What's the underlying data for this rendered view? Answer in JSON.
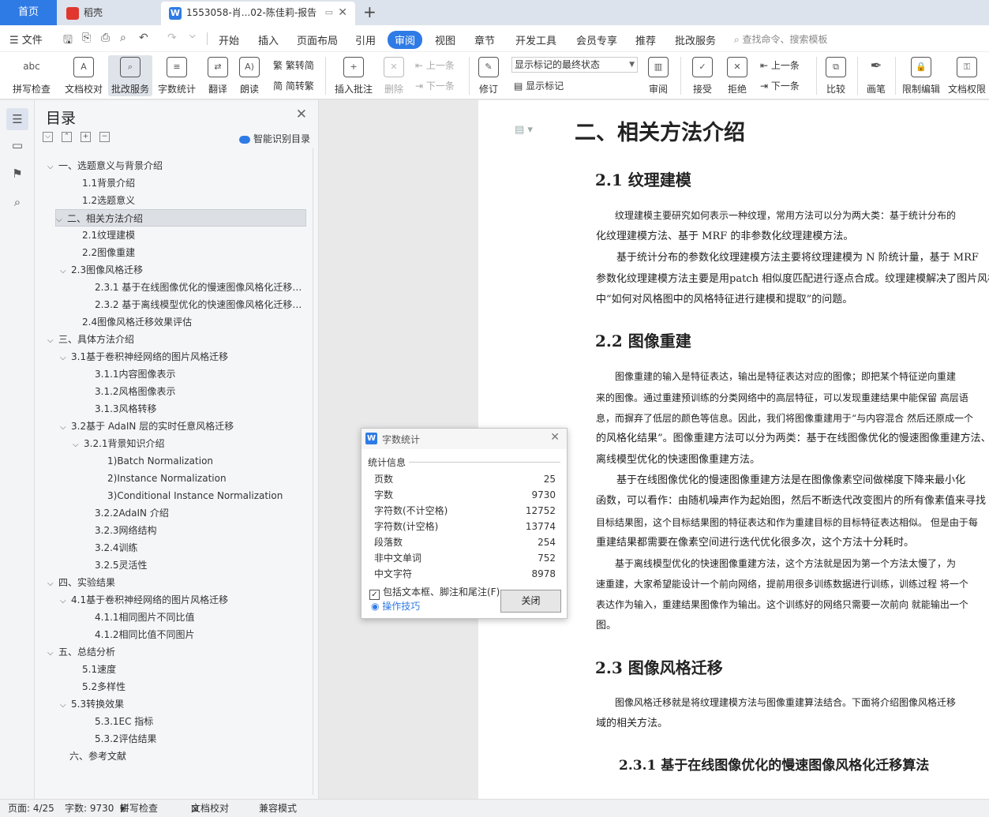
{
  "tabs": {
    "home": "首页",
    "t1": "稻壳",
    "t2": "1553058-肖...02-陈佳莉-报告",
    "add": "+",
    "doc_icon": "W"
  },
  "menu": {
    "file": "文件",
    "items": [
      "开始",
      "插入",
      "页面布局",
      "引用",
      "审阅",
      "视图",
      "章节",
      "开发工具",
      "会员专享",
      "推荐",
      "批改服务"
    ],
    "active": "审阅",
    "search": "查找命令、搜索模板"
  },
  "ribbon": {
    "spell": "拼写检查",
    "proof": "文档校对",
    "correct": "批改服务",
    "wordcount": "字数统计",
    "translate": "翻译",
    "read": "朗读",
    "trad": "繁转简",
    "simp": "简转繁",
    "insert_comment": "插入批注",
    "delete": "删除",
    "prev": "上一条",
    "next": "下一条",
    "revise": "修订",
    "markup_state": "显示标记的最终状态",
    "show_markup": "显示标记",
    "review": "审阅",
    "accept": "接受",
    "reject": "拒绝",
    "prev2": "上一条",
    "next2": "下一条",
    "compare": "比较",
    "pen": "画笔",
    "restrict": "限制编辑",
    "perm": "文档权限",
    "icon_abc": "abc"
  },
  "toc": {
    "title": "目录",
    "smart": "智能识别目录",
    "items": [
      {
        "label": "一、选题意义与背景介绍",
        "toggle": "⌵"
      },
      {
        "label": "1.1背景介绍",
        "toggle": ""
      },
      {
        "label": "1.2选题意义",
        "toggle": ""
      },
      {
        "label": "二、相关方法介绍",
        "toggle": "⌵"
      },
      {
        "label": "2.1纹理建模",
        "toggle": ""
      },
      {
        "label": "2.2图像重建",
        "toggle": ""
      },
      {
        "label": "2.3图像风格迁移",
        "toggle": "⌵"
      },
      {
        "label": "2.3.1 基于在线图像优化的慢速图像风格化迁移算法",
        "toggle": ""
      },
      {
        "label": "2.3.2 基于离线模型优化的快速图像风格化迁移算法",
        "toggle": ""
      },
      {
        "label": "2.4图像风格迁移效果评估",
        "toggle": ""
      },
      {
        "label": "三、具体方法介绍",
        "toggle": "⌵"
      },
      {
        "label": "3.1基于卷积神经网络的图片风格迁移",
        "toggle": "⌵"
      },
      {
        "label": "3.1.1内容图像表示",
        "toggle": ""
      },
      {
        "label": "3.1.2风格图像表示",
        "toggle": ""
      },
      {
        "label": "3.1.3风格转移",
        "toggle": ""
      },
      {
        "label": "3.2基于 AdaIN 层的实时任意风格迁移",
        "toggle": "⌵"
      },
      {
        "label": "3.2.1背景知识介绍",
        "toggle": "⌵"
      },
      {
        "label": "1)Batch Normalization",
        "toggle": ""
      },
      {
        "label": "2)Instance Normalization",
        "toggle": ""
      },
      {
        "label": "3)Conditional Instance Normalization",
        "toggle": ""
      },
      {
        "label": "3.2.2AdaIN 介绍",
        "toggle": ""
      },
      {
        "label": "3.2.3网络结构",
        "toggle": ""
      },
      {
        "label": "3.2.4训练",
        "toggle": ""
      },
      {
        "label": "3.2.5灵活性",
        "toggle": ""
      },
      {
        "label": "四、实验结果",
        "toggle": "⌵"
      },
      {
        "label": "4.1基于卷积神经网络的图片风格迁移",
        "toggle": "⌵"
      },
      {
        "label": "4.1.1相同图片不同比值",
        "toggle": ""
      },
      {
        "label": "4.1.2相同比值不同图片",
        "toggle": ""
      },
      {
        "label": "五、总结分析",
        "toggle": "⌵"
      },
      {
        "label": "5.1速度",
        "toggle": ""
      },
      {
        "label": "5.2多样性",
        "toggle": ""
      },
      {
        "label": "5.3转换效果",
        "toggle": "⌵"
      },
      {
        "label": "5.3.1EC 指标",
        "toggle": ""
      },
      {
        "label": "5.3.2评估结果",
        "toggle": ""
      },
      {
        "label": "六、参考文献",
        "toggle": ""
      }
    ]
  },
  "doc": {
    "h1": "二、相关方法介绍",
    "h_21": "2.1 纹理建模",
    "p21": [
      "　　纹理建模主要研究如何表示一种纹理，常用方法可以分为两大类：基于统计分布的",
      "化纹理建模方法、基于 MRF 的非参数化纹理建模方法。",
      "　　基于统计分布的参数化纹理建模方法主要将纹理建模为 N 阶统计量，基于 MRF",
      "参数化纹理建模方法主要是用patch 相似度匹配进行逐点合成。纹理建模解决了图片风格",
      "中“如何对风格图中的风格特征进行建模和提取”的问题。"
    ],
    "h_22": "2.2 图像重建",
    "p22": [
      "　　图像重建的输入是特征表达，输出是特征表达对应的图像；即把某个特征逆向重建",
      "来的图像。通过重建预训练的分类网络中的高层特征，可以发现重建结果中能保留 高层语",
      "息，而摒弃了低层的颜色等信息。因此，我们将图像重建用于“与内容混合 然后还原成一个",
      "的风格化结果”。图像重建方法可以分为两类：基于在线图像优化的慢速图像重建方法、",
      "离线模型优化的快速图像重建方法。",
      "　　基于在线图像优化的慢速图像重建方法是在图像像素空间做梯度下降来最小化",
      "函数，可以看作：由随机噪声作为起始图，然后不断迭代改变图片的所有像素值来寻找",
      "目标结果图，这个目标结果图的特征表达和作为重建目标的目标特征表达相似。 但是由于每",
      "重建结果都需要在像素空间进行迭代优化很多次，这个方法十分耗时。",
      "　　基于离线模型优化的快速图像重建方法，这个方法就是因为第一个方法太慢了，为",
      "速重建，大家希望能设计一个前向网络，提前用很多训练数据进行训练，训练过程 将一个",
      "表达作为输入，重建结果图像作为输出。这个训练好的网络只需要一次前向 就能输出一个",
      "图。"
    ],
    "h_23": "2.3 图像风格迁移",
    "p23": [
      "　　图像风格迁移就是将纹理建模方法与图像重建算法结合。下面将介绍图像风格迁移",
      "域的相关方法。"
    ],
    "h_231": "2.3.1 基于在线图像优化的慢速图像风格化迁移算法"
  },
  "dialog": {
    "icon": "W",
    "title": "字数统计",
    "section": "统计信息",
    "rows": [
      {
        "k": "页数",
        "v": "25"
      },
      {
        "k": "字数",
        "v": "9730"
      },
      {
        "k": "字符数(不计空格)",
        "v": "12752"
      },
      {
        "k": "字符数(计空格)",
        "v": "13774"
      },
      {
        "k": "段落数",
        "v": "254"
      },
      {
        "k": "非中文单词",
        "v": "752"
      },
      {
        "k": "中文字符",
        "v": "8978"
      }
    ],
    "include_label": "包括文本框、脚注和尾注(F)",
    "include_checked": true,
    "tips": "操作技巧",
    "close": "关闭"
  },
  "status": {
    "page": "页面: 4/25",
    "words": "字数: 9730",
    "spell": "拼写检查",
    "proof": "文档校对",
    "compat": "兼容模式"
  },
  "colors": {
    "accent": "#2f7be5",
    "tab_bg": "#dde3ec"
  }
}
